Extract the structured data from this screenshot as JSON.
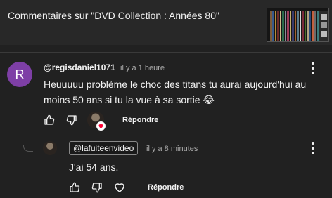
{
  "header": {
    "title": "Commentaires sur \"DVD Collection : Années 80\""
  },
  "comment": {
    "avatar_letter": "R",
    "author": "@regisdaniel1071",
    "time": "il y a 1 heure",
    "text": "Heuuuuu problème le choc des titans tu aurai aujourd'hui au moins 50 ans si tu la vue à sa sortie 😂",
    "reply_label": "Répondre"
  },
  "reply": {
    "author": "@lafuiteenvideo",
    "time": "il y a 8 minutes",
    "text": "J'ai 54 ans.",
    "reply_label": "Répondre"
  },
  "colors": {
    "background": "#212121",
    "header_background": "#282828",
    "avatar": "#7e3fa6",
    "heart": "#ff0033"
  }
}
